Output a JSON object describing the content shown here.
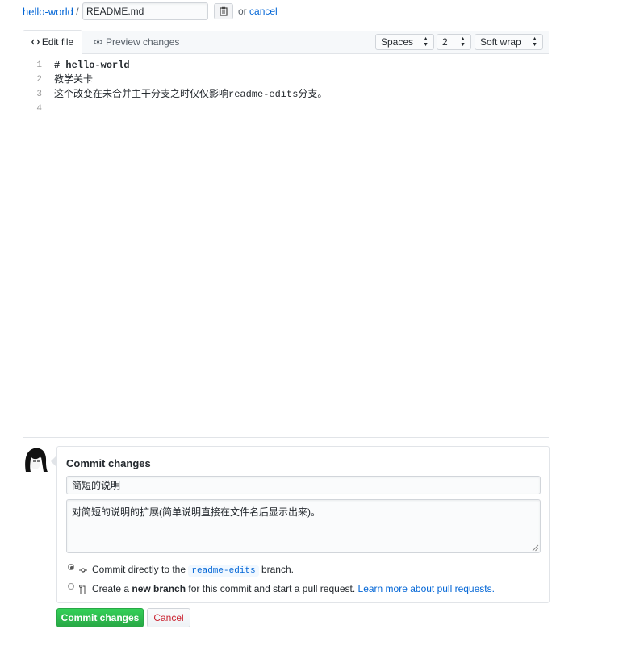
{
  "breadcrumb": {
    "repo_name": "hello-world",
    "separator": "/",
    "filename_value": "README.md",
    "or_text": "or",
    "cancel_link": "cancel"
  },
  "editor_tabs": {
    "edit_label": "Edit file",
    "preview_label": "Preview changes"
  },
  "editor_options": {
    "indent_mode": "Spaces",
    "indent_size": "2",
    "wrap_mode": "Soft wrap"
  },
  "editor": {
    "line_numbers": [
      "1",
      "2",
      "3",
      "4"
    ],
    "lines": [
      "# hello-world",
      "教学关卡",
      "这个改变在未合并主干分支之时仅仅影响readme-edits分支。",
      ""
    ]
  },
  "commit": {
    "title": "Commit changes",
    "summary_value": "简短的说明",
    "description_value": "对简短的说明的扩展(简单说明直接在文件名后显示出来)。",
    "option_direct": {
      "prefix": "Commit directly to the",
      "branch": "readme-edits",
      "suffix": "branch."
    },
    "option_new_branch": {
      "prefix": "Create a",
      "bold": "new branch",
      "middle": "for this commit and start a pull request.",
      "link": "Learn more about pull requests."
    },
    "commit_button": "Commit changes",
    "cancel_button": "Cancel"
  },
  "colors": {
    "link": "#0366d6",
    "commit_green": "#28a745",
    "cancel_red": "#cb2431"
  },
  "icons": {
    "clipboard": "clipboard-icon",
    "code": "code-icon",
    "eye": "eye-icon",
    "commit": "git-commit-icon",
    "pull_request": "git-pull-request-icon"
  }
}
